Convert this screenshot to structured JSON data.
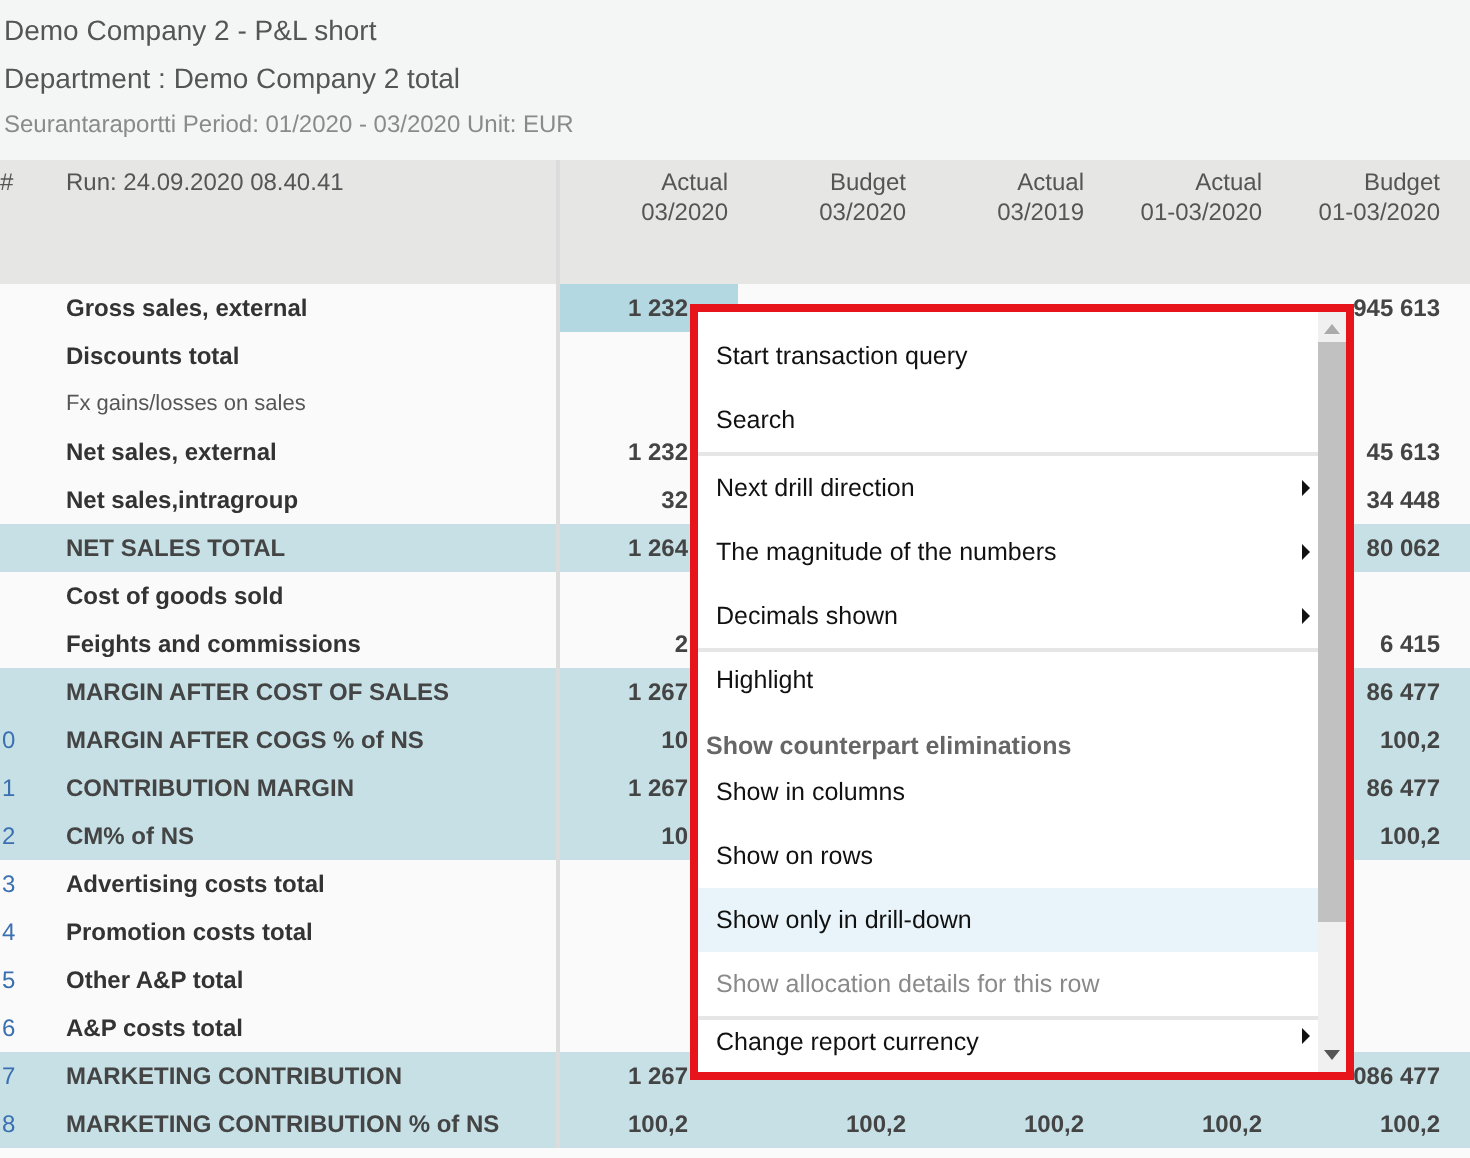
{
  "report": {
    "title": "Demo Company 2 - P&L short",
    "department": "Department : Demo Company 2 total",
    "subtitle": "Seurantaraportti Period: 01/2020 - 03/2020 Unit: EUR"
  },
  "table": {
    "number_heading": "#",
    "run": "Run: 24.09.2020 08.40.41",
    "columns": [
      {
        "line1": "Actual",
        "line2": "03/2020"
      },
      {
        "line1": "Budget",
        "line2": "03/2020"
      },
      {
        "line1": "Actual",
        "line2": "03/2019"
      },
      {
        "line1": "Actual",
        "line2": "01-03/2020"
      },
      {
        "line1": "Budget",
        "line2": "01-03/2020"
      }
    ],
    "rows": [
      {
        "kind": "normal",
        "label": "Gross sales, external",
        "selected": true,
        "values": {
          "column_1": "1 232",
          "column_5": "945 613"
        }
      },
      {
        "kind": "normal",
        "label": "Discounts total",
        "selected": false
      },
      {
        "kind": "sub",
        "label": "Fx gains/losses on sales",
        "selected": false
      },
      {
        "kind": "normal",
        "label": "Net sales, external",
        "selected": false,
        "values": {
          "column_1": "1 232",
          "column_5": "45 613"
        }
      },
      {
        "kind": "normal",
        "label": "Net sales,intragroup",
        "selected": false,
        "values": {
          "column_1": "32",
          "column_5": "34 448"
        }
      },
      {
        "kind": "total",
        "label": "NET SALES TOTAL",
        "selected": false,
        "values": {
          "column_1": "1 264",
          "column_5": "80 062"
        }
      },
      {
        "kind": "normal",
        "label": "Cost of goods sold",
        "selected": false
      },
      {
        "kind": "normal",
        "label": "Feights and commissions",
        "selected": false,
        "values": {
          "column_1": "2",
          "column_5": "6 415"
        }
      },
      {
        "kind": "total",
        "label": "MARGIN AFTER COST OF SALES",
        "selected": false,
        "values": {
          "column_1": "1 267",
          "column_5": "86 477"
        }
      },
      {
        "kind": "total",
        "number": "0",
        "label": "MARGIN AFTER COGS % of NS",
        "selected": false,
        "values": {
          "column_1": "10",
          "column_5": "100,2"
        }
      },
      {
        "kind": "total",
        "number": "1",
        "label": "CONTRIBUTION MARGIN",
        "selected": false,
        "values": {
          "column_1": "1 267",
          "column_5": "86 477"
        }
      },
      {
        "kind": "total",
        "number": "2",
        "label": "CM% of NS",
        "selected": false,
        "values": {
          "column_1": "10",
          "column_5": "100,2"
        }
      },
      {
        "kind": "normal",
        "number": "3",
        "label": "Advertising costs total",
        "selected": false
      },
      {
        "kind": "normal",
        "number": "4",
        "label": "Promotion costs total",
        "selected": false
      },
      {
        "kind": "normal",
        "number": "5",
        "label": "Other A&P total",
        "selected": false
      },
      {
        "kind": "normal",
        "number": "6",
        "label": "A&P costs total",
        "selected": false
      },
      {
        "kind": "total",
        "number": "7",
        "label": "MARKETING CONTRIBUTION",
        "selected": false,
        "values": {
          "column_1": "1 267",
          "column_5": "086 477"
        }
      },
      {
        "kind": "total",
        "number": "8",
        "label": "MARKETING CONTRIBUTION % of NS",
        "selected": false,
        "values": {
          "column_1": "100,2",
          "column_2": "100,2",
          "column_3": "100,2",
          "column_4": "100,2",
          "column_5": "100,2"
        }
      }
    ]
  },
  "context_menu": {
    "items": [
      {
        "kind": "item",
        "label": "Start transaction query",
        "submenu": false,
        "disabled": false,
        "selected": false
      },
      {
        "kind": "item",
        "label": "Search",
        "submenu": false,
        "disabled": false,
        "selected": false
      },
      {
        "kind": "separator"
      },
      {
        "kind": "item",
        "label": "Next drill direction",
        "submenu": true,
        "disabled": false,
        "selected": false
      },
      {
        "kind": "item",
        "label": "The magnitude of the numbers",
        "submenu": true,
        "disabled": false,
        "selected": false
      },
      {
        "kind": "item",
        "label": "Decimals shown",
        "submenu": true,
        "disabled": false,
        "selected": false
      },
      {
        "kind": "separator"
      },
      {
        "kind": "item",
        "label": "Highlight",
        "submenu": false,
        "disabled": false,
        "selected": false
      },
      {
        "kind": "header",
        "label": "Show counterpart eliminations"
      },
      {
        "kind": "item",
        "label": "Show in columns",
        "submenu": false,
        "disabled": false,
        "selected": false
      },
      {
        "kind": "item",
        "label": "Show on rows",
        "submenu": false,
        "disabled": false,
        "selected": false
      },
      {
        "kind": "item",
        "label": "Show only in drill-down",
        "submenu": false,
        "disabled": false,
        "selected": true
      },
      {
        "kind": "item",
        "label": "Show allocation details for this row",
        "submenu": false,
        "disabled": true,
        "selected": false
      },
      {
        "kind": "separator"
      },
      {
        "kind": "item",
        "label": "Change report currency",
        "submenu": true,
        "disabled": false,
        "selected": false
      }
    ]
  }
}
